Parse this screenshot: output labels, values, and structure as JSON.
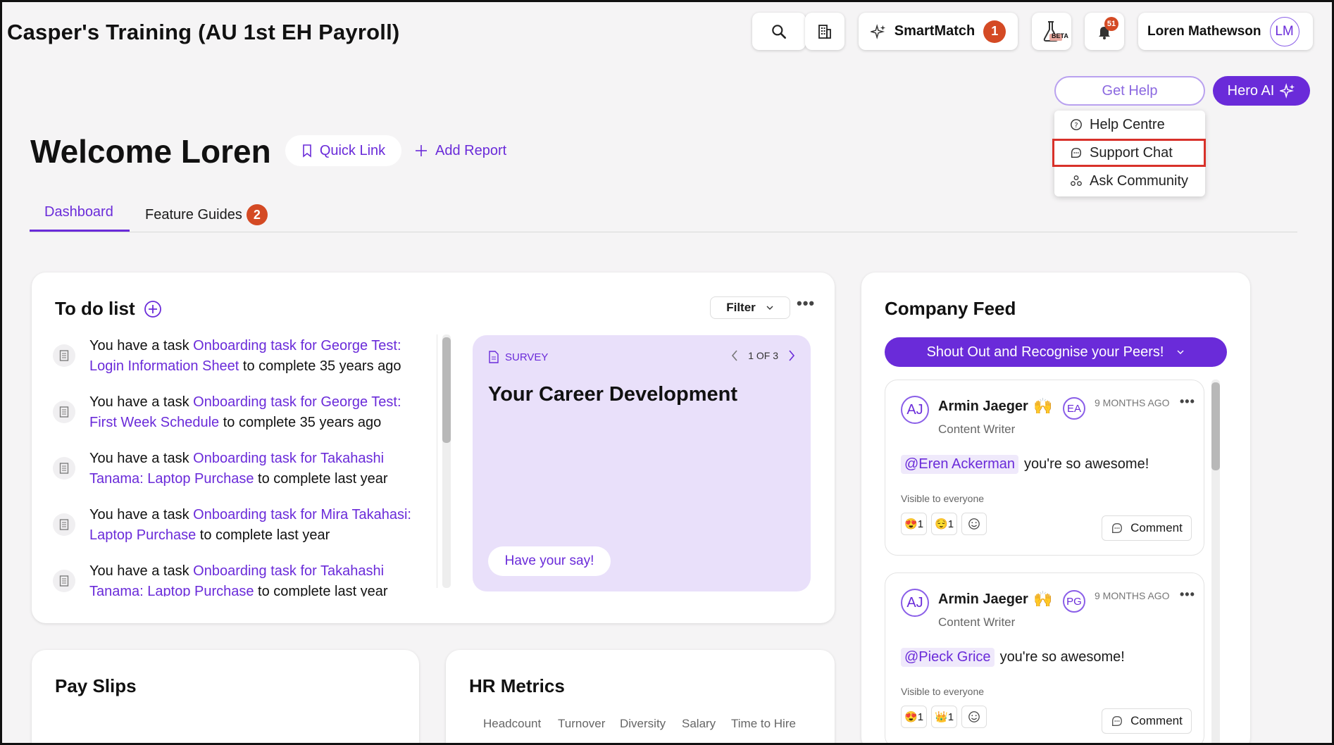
{
  "header": {
    "title": "Casper's Training (AU 1st EH Payroll)",
    "smartmatch_label": "SmartMatch",
    "smartmatch_badge": "1",
    "beta_label": "BETA",
    "notifications_badge": "51",
    "user_name": "Loren Mathewson",
    "user_initials": "LM"
  },
  "help": {
    "get_help_label": "Get Help",
    "hero_ai_label": "Hero AI",
    "menu": [
      {
        "label": "Help Centre",
        "icon": "question-icon"
      },
      {
        "label": "Support Chat",
        "icon": "chat-icon",
        "highlighted": true
      },
      {
        "label": "Ask Community",
        "icon": "community-icon"
      }
    ]
  },
  "page": {
    "welcome": "Welcome Loren",
    "quick_link_label": "Quick Link",
    "add_report_label": "Add Report"
  },
  "tabs": {
    "dashboard": "Dashboard",
    "feature_guides": "Feature Guides",
    "feature_guides_badge": "2"
  },
  "todo": {
    "title": "To do list",
    "filter_label": "Filter",
    "items": [
      {
        "prefix": "You have a task ",
        "link": "Onboarding task for George Test: Login Information Sheet",
        "suffix": " to complete 35 years ago"
      },
      {
        "prefix": "You have a task ",
        "link": "Onboarding task for George Test: First Week Schedule",
        "suffix": " to complete 35 years ago"
      },
      {
        "prefix": "You have a task ",
        "link": "Onboarding task for Takahashi Tanama: Laptop Purchase",
        "suffix": " to complete last year"
      },
      {
        "prefix": "You have a task ",
        "link": "Onboarding task for Mira Takahasi: Laptop Purchase",
        "suffix": " to complete last year"
      },
      {
        "prefix": "You have a task ",
        "link": "Onboarding task for Takahashi Tanama: Laptop Purchase",
        "suffix": " to complete last year"
      }
    ],
    "survey": {
      "tag": "SURVEY",
      "pager": "1 OF 3",
      "title": "Your Career Development",
      "button": "Have your say!"
    }
  },
  "feed": {
    "title": "Company Feed",
    "shout_out_label": "Shout Out and Recognise your Peers!",
    "posts": [
      {
        "author_initials": "AJ",
        "author": "Armin Jaeger",
        "role": "Content Writer",
        "recipient_initials": "EA",
        "time": "9 MONTHS AGO",
        "mention": "@Eren Ackerman",
        "message": "you're so awesome!",
        "visibility": "Visible to everyone",
        "reactions": [
          {
            "emoji": "😍",
            "count": "1"
          },
          {
            "emoji": "😌",
            "count": "1"
          }
        ],
        "comment_label": "Comment"
      },
      {
        "author_initials": "AJ",
        "author": "Armin Jaeger",
        "role": "Content Writer",
        "recipient_initials": "PG",
        "time": "9 MONTHS AGO",
        "mention": "@Pieck Grice",
        "message": "you're so awesome!",
        "visibility": "Visible to everyone",
        "reactions": [
          {
            "emoji": "😍",
            "count": "1"
          },
          {
            "emoji": "👑",
            "count": "1"
          }
        ],
        "comment_label": "Comment"
      }
    ]
  },
  "payslips": {
    "title": "Pay Slips"
  },
  "hr_metrics": {
    "title": "HR Metrics",
    "tabs": [
      "Headcount",
      "Turnover",
      "Diversity",
      "Salary",
      "Time to Hire"
    ]
  },
  "colors": {
    "accent": "#6a2bd9",
    "badge": "#d44a24",
    "highlight_border": "#d8312a"
  }
}
